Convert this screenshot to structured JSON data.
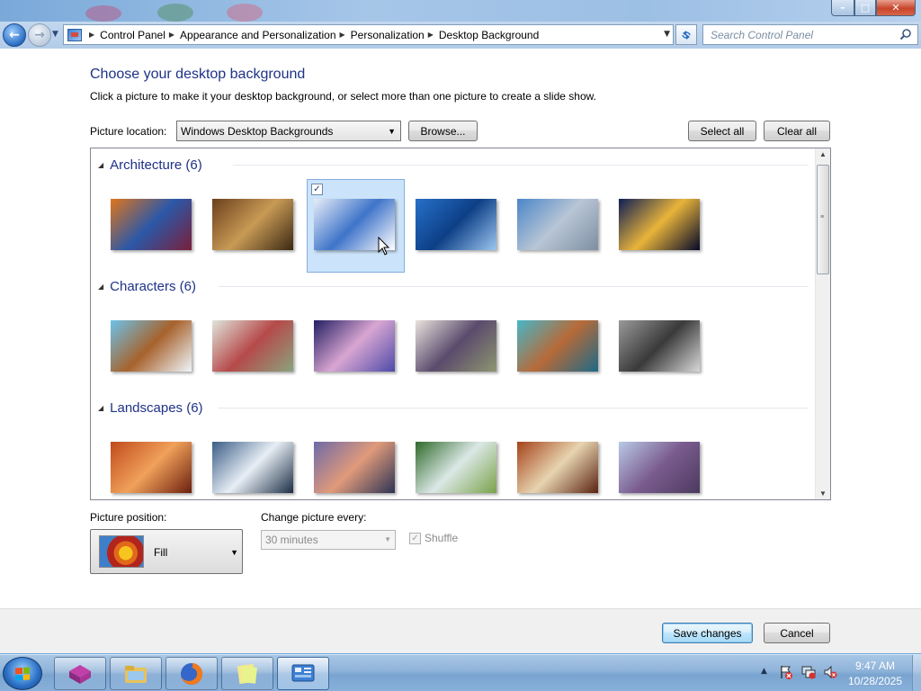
{
  "window": {
    "buttons": {
      "minimize": "–",
      "maximize": "□",
      "close": "✕"
    }
  },
  "nav": {
    "back_glyph": "←",
    "forward_glyph": "→",
    "breadcrumbs": [
      "Control Panel",
      "Appearance and Personalization",
      "Personalization",
      "Desktop Background"
    ],
    "search_placeholder": "Search Control Panel"
  },
  "page": {
    "title": "Choose your desktop background",
    "subtitle": "Click a picture to make it your desktop background, or select more than one picture to create a slide show."
  },
  "location": {
    "label": "Picture location:",
    "value": "Windows Desktop Backgrounds",
    "browse_label": "Browse...",
    "select_all_label": "Select all",
    "clear_all_label": "Clear all"
  },
  "groups": [
    {
      "title": "Architecture (6)",
      "pictures": [
        {
          "name": "architecture-1",
          "colors": [
            "#e0751c",
            "#2b58a8",
            "#7a1f3a"
          ],
          "selected": false
        },
        {
          "name": "architecture-2",
          "colors": [
            "#6b3f1c",
            "#c89a55",
            "#3a2814"
          ],
          "selected": false
        },
        {
          "name": "architecture-3",
          "colors": [
            "#e8eef8",
            "#3f74c9",
            "#ffffff"
          ],
          "selected": true
        },
        {
          "name": "architecture-4",
          "colors": [
            "#2770c9",
            "#0d3f86",
            "#9cc6f0"
          ],
          "selected": false
        },
        {
          "name": "architecture-5",
          "colors": [
            "#4a86c8",
            "#b8c5d5",
            "#7e8fa3"
          ],
          "selected": false
        },
        {
          "name": "architecture-6",
          "colors": [
            "#0d1d55",
            "#e8b43a",
            "#04082a"
          ],
          "selected": false
        }
      ]
    },
    {
      "title": "Characters (6)",
      "pictures": [
        {
          "name": "characters-1",
          "colors": [
            "#6cc2ea",
            "#a7622c",
            "#f0f6fb"
          ],
          "selected": false
        },
        {
          "name": "characters-2",
          "colors": [
            "#dfe5dc",
            "#b64a4a",
            "#8aa37e"
          ],
          "selected": false
        },
        {
          "name": "characters-3",
          "colors": [
            "#221e62",
            "#d9a6d2",
            "#4e4aa8"
          ],
          "selected": false
        },
        {
          "name": "characters-4",
          "colors": [
            "#e8e4dd",
            "#5b4a6d",
            "#8d9670"
          ],
          "selected": false
        },
        {
          "name": "characters-5",
          "colors": [
            "#47b6c8",
            "#b76a38",
            "#1d6a87"
          ],
          "selected": false
        },
        {
          "name": "characters-6",
          "colors": [
            "#9a9a9a",
            "#3a3a3a",
            "#d8d8d8"
          ],
          "selected": false
        }
      ]
    },
    {
      "title": "Landscapes (6)",
      "pictures": [
        {
          "name": "landscapes-1",
          "colors": [
            "#c14a1c",
            "#f0a15a",
            "#6b1f0e"
          ],
          "selected": false
        },
        {
          "name": "landscapes-2",
          "colors": [
            "#3b5d86",
            "#e7eef5",
            "#1c2e45"
          ],
          "selected": false
        },
        {
          "name": "landscapes-3",
          "colors": [
            "#6f6aa8",
            "#e09a7a",
            "#2d3355"
          ],
          "selected": false
        },
        {
          "name": "landscapes-4",
          "colors": [
            "#2f6a2a",
            "#dbe8e6",
            "#79a24a"
          ],
          "selected": false
        },
        {
          "name": "landscapes-5",
          "colors": [
            "#a5431a",
            "#e7d4b0",
            "#5a2210"
          ],
          "selected": false
        },
        {
          "name": "landscapes-6",
          "colors": [
            "#b9c9e6",
            "#7a5c8f",
            "#4c3a5e"
          ],
          "selected": false
        }
      ]
    }
  ],
  "position": {
    "label": "Picture position:",
    "value": "Fill"
  },
  "interval": {
    "label": "Change picture every:",
    "value": "30 minutes",
    "shuffle_label": "Shuffle",
    "shuffle_checked": true,
    "disabled": true
  },
  "footer": {
    "save_label": "Save changes",
    "cancel_label": "Cancel"
  },
  "taskbar": {
    "apps": [
      "wallpaper-app",
      "file-explorer",
      "firefox",
      "notes-app",
      "control-panel"
    ],
    "active_app": "control-panel",
    "tray_arrow": "▲",
    "clock_time": "9:47 AM",
    "clock_date": "10/28/2025"
  }
}
